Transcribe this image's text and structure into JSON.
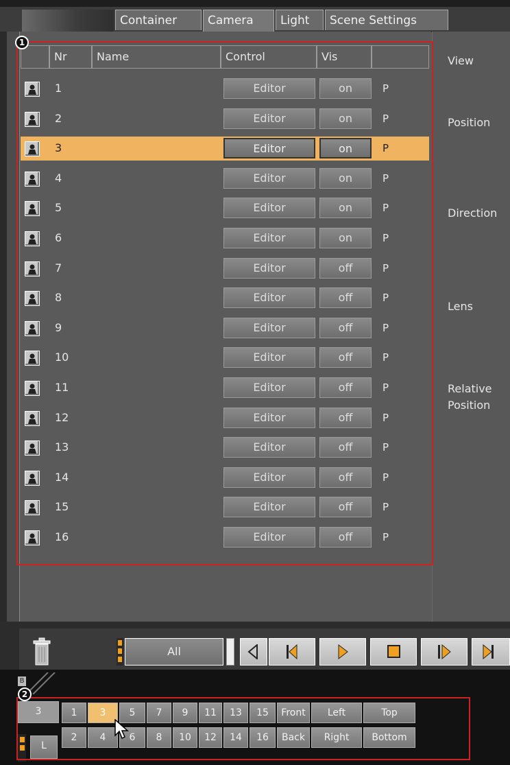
{
  "tabs": [
    "Container",
    "Camera",
    "Light",
    "Scene Settings"
  ],
  "active_tab": "Camera",
  "table": {
    "headers": [
      "Nr",
      "Name",
      "Control",
      "Vis"
    ],
    "rows": [
      {
        "nr": "1",
        "control": "Editor",
        "vis": "on",
        "p": "P"
      },
      {
        "nr": "2",
        "control": "Editor",
        "vis": "on",
        "p": "P"
      },
      {
        "nr": "3",
        "control": "Editor",
        "vis": "on",
        "p": "P",
        "selected": true
      },
      {
        "nr": "4",
        "control": "Editor",
        "vis": "on",
        "p": "P"
      },
      {
        "nr": "5",
        "control": "Editor",
        "vis": "on",
        "p": "P"
      },
      {
        "nr": "6",
        "control": "Editor",
        "vis": "on",
        "p": "P"
      },
      {
        "nr": "7",
        "control": "Editor",
        "vis": "off",
        "p": "P"
      },
      {
        "nr": "8",
        "control": "Editor",
        "vis": "off",
        "p": "P"
      },
      {
        "nr": "9",
        "control": "Editor",
        "vis": "off",
        "p": "P"
      },
      {
        "nr": "10",
        "control": "Editor",
        "vis": "off",
        "p": "P"
      },
      {
        "nr": "11",
        "control": "Editor",
        "vis": "off",
        "p": "P"
      },
      {
        "nr": "12",
        "control": "Editor",
        "vis": "off",
        "p": "P"
      },
      {
        "nr": "13",
        "control": "Editor",
        "vis": "off",
        "p": "P"
      },
      {
        "nr": "14",
        "control": "Editor",
        "vis": "off",
        "p": "P"
      },
      {
        "nr": "15",
        "control": "Editor",
        "vis": "off",
        "p": "P"
      },
      {
        "nr": "16",
        "control": "Editor",
        "vis": "off",
        "p": "P"
      }
    ]
  },
  "side_panel": {
    "view": "View",
    "position": "Position",
    "direction": "Direction",
    "lens": "Lens",
    "relative_line1": "Relative",
    "relative_line2": "Position"
  },
  "annotations": {
    "badge1": "1",
    "badge2": "2"
  },
  "toolbar": {
    "all_label": "All"
  },
  "camera_selector": {
    "current": "3",
    "top_row": [
      "1",
      "3",
      "5",
      "7",
      "9",
      "11",
      "13",
      "15",
      "Front",
      "Left",
      "Top"
    ],
    "bottom_row": [
      "2",
      "4",
      "6",
      "8",
      "10",
      "12",
      "14",
      "16",
      "Back",
      "Right",
      "Bottom"
    ],
    "selected": "3",
    "left_tag": "L",
    "small_tag": "B"
  },
  "colors": {
    "selection": "#f0b360",
    "annotation": "#cc2222",
    "transport_accent": "#f0a020"
  },
  "icons": [
    "camera-icon",
    "trash-icon",
    "step-back-icon",
    "skip-start-icon",
    "play-icon",
    "stop-icon",
    "step-forward-icon",
    "skip-end-icon",
    "cursor-icon"
  ]
}
